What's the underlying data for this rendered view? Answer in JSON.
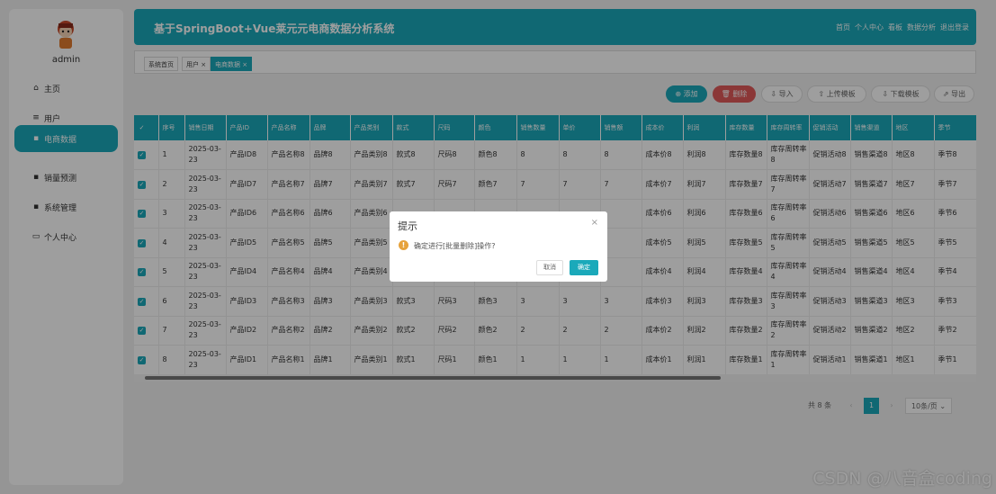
{
  "sidebar": {
    "username": "admin",
    "items": [
      {
        "icon": "home-icon",
        "label": "主页"
      },
      {
        "icon": "list-icon",
        "label": "用户"
      },
      {
        "icon": "grid-icon",
        "label": "电商数据"
      },
      {
        "icon": "grid-icon",
        "label": "销量预测"
      },
      {
        "icon": "grid-icon",
        "label": "系统管理"
      },
      {
        "icon": "calendar-icon",
        "label": "个人中心"
      }
    ],
    "active_index": 2
  },
  "header": {
    "title": "基于SpringBoot+Vue莱元元电商数据分析系统",
    "links": [
      "首页",
      "个人中心",
      "看板",
      "数据分析",
      "退出登录"
    ]
  },
  "tabs": [
    {
      "label": "系统首页"
    },
    {
      "label": "用户 ×"
    },
    {
      "label": "电商数据 ×"
    }
  ],
  "toolbar": {
    "add": "添加",
    "delete": "删除",
    "import": "导入",
    "upload_template": "上传模板",
    "download_template": "下载模板",
    "export": "导出"
  },
  "table": {
    "headers": [
      "序号",
      "销售日期",
      "产品ID",
      "产品名称",
      "品牌",
      "产品类别",
      "款式",
      "尺码",
      "颜色",
      "销售数量",
      "单价",
      "销售额",
      "成本价",
      "利润",
      "库存数量",
      "库存周转率",
      "促销活动",
      "销售渠道",
      "地区",
      "季节"
    ],
    "rows": [
      [
        "1",
        "2025-03-23",
        "产品ID8",
        "产品名称8",
        "品牌8",
        "产品类别8",
        "款式8",
        "尺码8",
        "颜色8",
        "8",
        "8",
        "8",
        "成本价8",
        "利润8",
        "库存数量8",
        "库存周转率8",
        "促销活动8",
        "销售渠道8",
        "地区8",
        "季节8"
      ],
      [
        "2",
        "2025-03-23",
        "产品ID7",
        "产品名称7",
        "品牌7",
        "产品类别7",
        "款式7",
        "尺码7",
        "颜色7",
        "7",
        "7",
        "7",
        "成本价7",
        "利润7",
        "库存数量7",
        "库存周转率7",
        "促销活动7",
        "销售渠道7",
        "地区7",
        "季节7"
      ],
      [
        "3",
        "2025-03-23",
        "产品ID6",
        "产品名称6",
        "品牌6",
        "产品类别6",
        "",
        "",
        "",
        "",
        "",
        "",
        "成本价6",
        "利润6",
        "库存数量6",
        "库存周转率6",
        "促销活动6",
        "销售渠道6",
        "地区6",
        "季节6"
      ],
      [
        "4",
        "2025-03-23",
        "产品ID5",
        "产品名称5",
        "品牌5",
        "产品类别5",
        "",
        "",
        "",
        "",
        "",
        "",
        "成本价5",
        "利润5",
        "库存数量5",
        "库存周转率5",
        "促销活动5",
        "销售渠道5",
        "地区5",
        "季节5"
      ],
      [
        "5",
        "2025-03-23",
        "产品ID4",
        "产品名称4",
        "品牌4",
        "产品类别4",
        "",
        "",
        "",
        "",
        "",
        "",
        "成本价4",
        "利润4",
        "库存数量4",
        "库存周转率4",
        "促销活动4",
        "销售渠道4",
        "地区4",
        "季节4"
      ],
      [
        "6",
        "2025-03-23",
        "产品ID3",
        "产品名称3",
        "品牌3",
        "产品类别3",
        "款式3",
        "尺码3",
        "颜色3",
        "3",
        "3",
        "3",
        "成本价3",
        "利润3",
        "库存数量3",
        "库存周转率3",
        "促销活动3",
        "销售渠道3",
        "地区3",
        "季节3"
      ],
      [
        "7",
        "2025-03-23",
        "产品ID2",
        "产品名称2",
        "品牌2",
        "产品类别2",
        "款式2",
        "尺码2",
        "颜色2",
        "2",
        "2",
        "2",
        "成本价2",
        "利润2",
        "库存数量2",
        "库存周转率2",
        "促销活动2",
        "销售渠道2",
        "地区2",
        "季节2"
      ],
      [
        "8",
        "2025-03-23",
        "产品ID1",
        "产品名称1",
        "品牌1",
        "产品类别1",
        "款式1",
        "尺码1",
        "颜色1",
        "1",
        "1",
        "1",
        "成本价1",
        "利润1",
        "库存数量1",
        "库存周转率1",
        "促销活动1",
        "销售渠道1",
        "地区1",
        "季节1"
      ]
    ]
  },
  "pagination": {
    "total": "共 8 条",
    "current_page": "1",
    "page_size": "10条/页"
  },
  "dialog": {
    "title": "提示",
    "message": "确定进行[批量删除]操作?",
    "cancel": "取消",
    "confirm": "确定"
  },
  "watermark": "CSDN @八音盒coding",
  "colors": {
    "primary": "#1ba9ba",
    "danger": "#e05a5a",
    "warning": "#e6a23c"
  }
}
